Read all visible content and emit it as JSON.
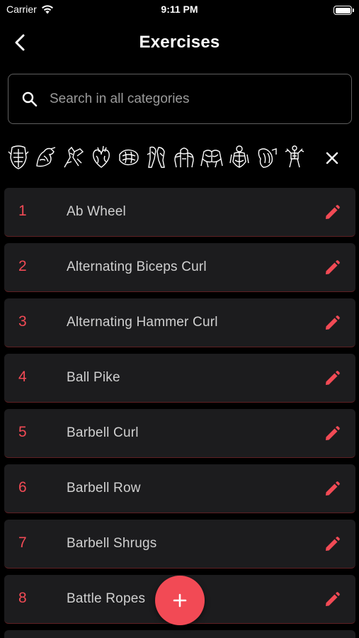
{
  "status_bar": {
    "carrier": "Carrier",
    "time": "9:11 PM",
    "battery_level": 1.0
  },
  "header": {
    "title": "Exercises",
    "back_icon": "chevron-left-icon"
  },
  "search": {
    "placeholder": "Search in all categories",
    "value": ""
  },
  "categories": [
    {
      "icon": "abs-muscle-icon"
    },
    {
      "icon": "biceps-muscle-icon"
    },
    {
      "icon": "forearms-muscle-icon"
    },
    {
      "icon": "cardio-heart-icon"
    },
    {
      "icon": "lats-muscle-icon"
    },
    {
      "icon": "legs-muscle-icon"
    },
    {
      "icon": "shoulders-muscle-icon"
    },
    {
      "icon": "chest-muscle-icon"
    },
    {
      "icon": "back-muscle-icon"
    },
    {
      "icon": "triceps-muscle-icon"
    },
    {
      "icon": "full-body-icon"
    }
  ],
  "exercises": [
    {
      "number": "1",
      "name": "Ab Wheel"
    },
    {
      "number": "2",
      "name": "Alternating Biceps Curl"
    },
    {
      "number": "3",
      "name": "Alternating Hammer Curl"
    },
    {
      "number": "4",
      "name": "Ball Pike"
    },
    {
      "number": "5",
      "name": "Barbell Curl"
    },
    {
      "number": "6",
      "name": "Barbell Row"
    },
    {
      "number": "7",
      "name": "Barbell Shrugs"
    },
    {
      "number": "8",
      "name": "Battle Ropes"
    }
  ],
  "colors": {
    "accent": "#f24a55",
    "background": "#000000",
    "row_background": "#1c1c1e",
    "text_primary": "#ffffff",
    "text_secondary": "#d0d0d0",
    "placeholder": "#9a9a9a"
  },
  "fab_icon": "plus-icon"
}
